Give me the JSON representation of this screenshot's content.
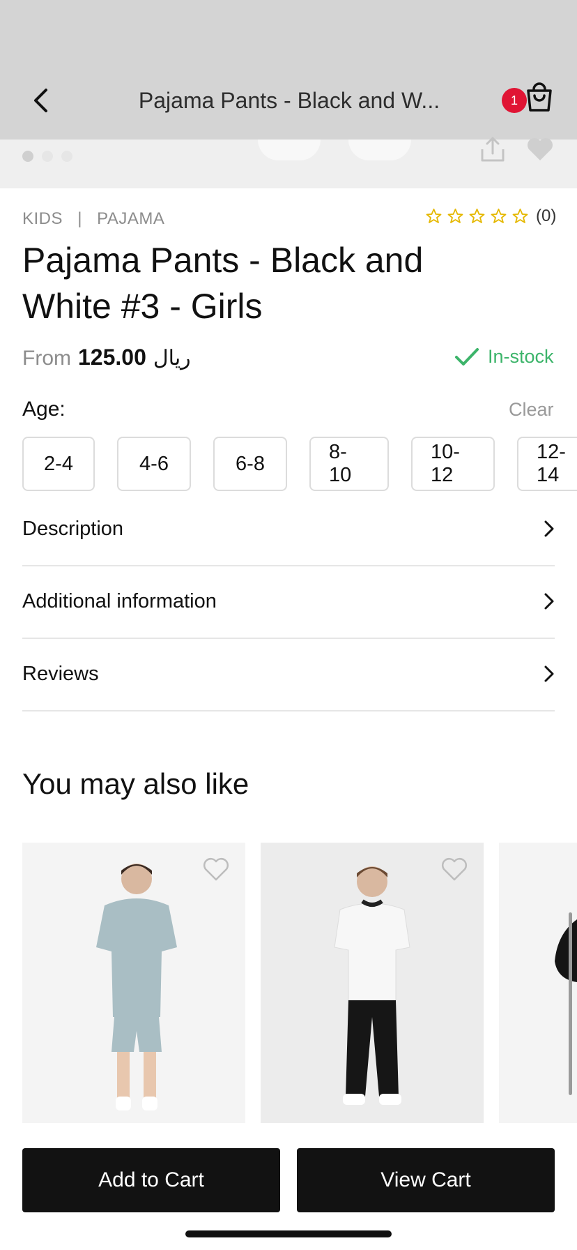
{
  "header": {
    "title": "Pajama Pants - Black and W...",
    "cart_badge": "1"
  },
  "breadcrumb": {
    "category": "KIDS",
    "separator": "|",
    "subcategory": "PAJAMA"
  },
  "rating": {
    "stars_filled": 0,
    "stars_total": 5,
    "count": "(0)"
  },
  "product": {
    "title": "Pajama Pants - Black and White #3 - Girls",
    "price_prefix": "From",
    "price": "125.00",
    "currency": "ريال",
    "stock": "In-stock"
  },
  "age": {
    "label": "Age:",
    "clear": "Clear",
    "options": [
      "2-4",
      "4-6",
      "6-8",
      "8-10",
      "10-12",
      "12-14"
    ]
  },
  "accordion": {
    "items": [
      "Description",
      "Additional information",
      "Reviews"
    ]
  },
  "recommendations": {
    "title": "You may also like"
  },
  "actions": {
    "add_to_cart": "Add to Cart",
    "view_cart": "View Cart"
  },
  "colors": {
    "badge": "#e01434",
    "stock": "#3cb46a",
    "star": "#e5b800",
    "button": "#121212"
  }
}
